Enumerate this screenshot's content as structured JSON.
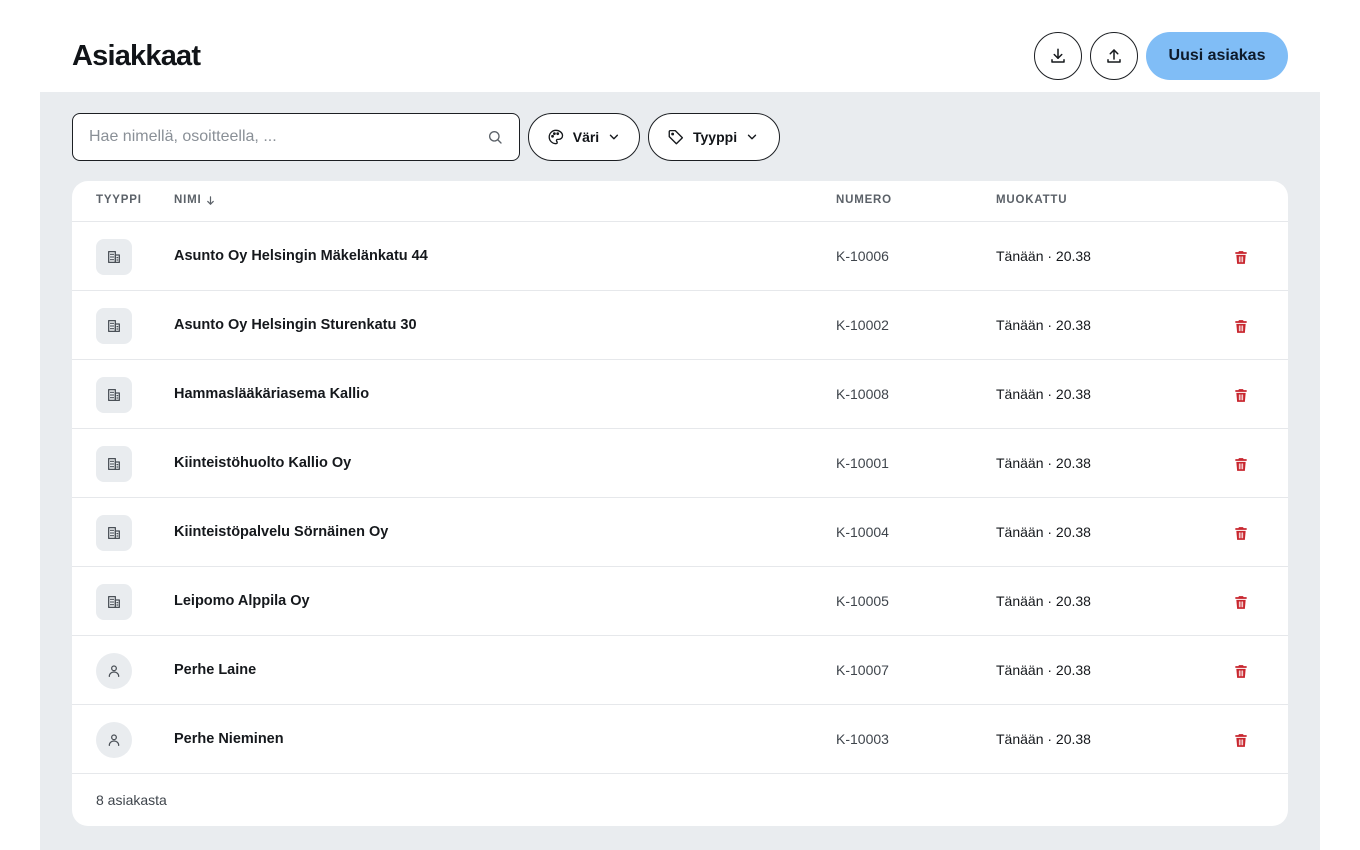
{
  "header": {
    "title": "Asiakkaat",
    "new_button": "Uusi asiakas",
    "download_icon": "download-icon",
    "upload_icon": "upload-icon"
  },
  "toolbar": {
    "search_placeholder": "Hae nimellä, osoitteella, ...",
    "search_value": "",
    "color_filter": "Väri",
    "type_filter": "Tyyppi"
  },
  "table": {
    "columns": {
      "type": "TYYPPI",
      "name": "NIMI",
      "number": "NUMERO",
      "modified": "MUOKATTU"
    },
    "sort": {
      "column": "name",
      "direction": "asc"
    },
    "rows": [
      {
        "kind": "company",
        "name": "Asunto Oy Helsingin Mäkelänkatu 44",
        "number": "K-10006",
        "modified": "Tänään · 20.38"
      },
      {
        "kind": "company",
        "name": "Asunto Oy Helsingin Sturenkatu 30",
        "number": "K-10002",
        "modified": "Tänään · 20.38"
      },
      {
        "kind": "company",
        "name": "Hammaslääkäriasema Kallio",
        "number": "K-10008",
        "modified": "Tänään · 20.38"
      },
      {
        "kind": "company",
        "name": "Kiinteistöhuolto Kallio Oy",
        "number": "K-10001",
        "modified": "Tänään · 20.38"
      },
      {
        "kind": "company",
        "name": "Kiinteistöpalvelu Sörnäinen Oy",
        "number": "K-10004",
        "modified": "Tänään · 20.38"
      },
      {
        "kind": "company",
        "name": "Leipomo Alppila Oy",
        "number": "K-10005",
        "modified": "Tänään · 20.38"
      },
      {
        "kind": "person",
        "name": "Perhe Laine",
        "number": "K-10007",
        "modified": "Tänään · 20.38"
      },
      {
        "kind": "person",
        "name": "Perhe Nieminen",
        "number": "K-10003",
        "modified": "Tänään · 20.38"
      }
    ],
    "footer": "8 asiakasta"
  },
  "colors": {
    "primary": "#80bdf6",
    "danger": "#c8262e",
    "background": "#e9ecef"
  }
}
